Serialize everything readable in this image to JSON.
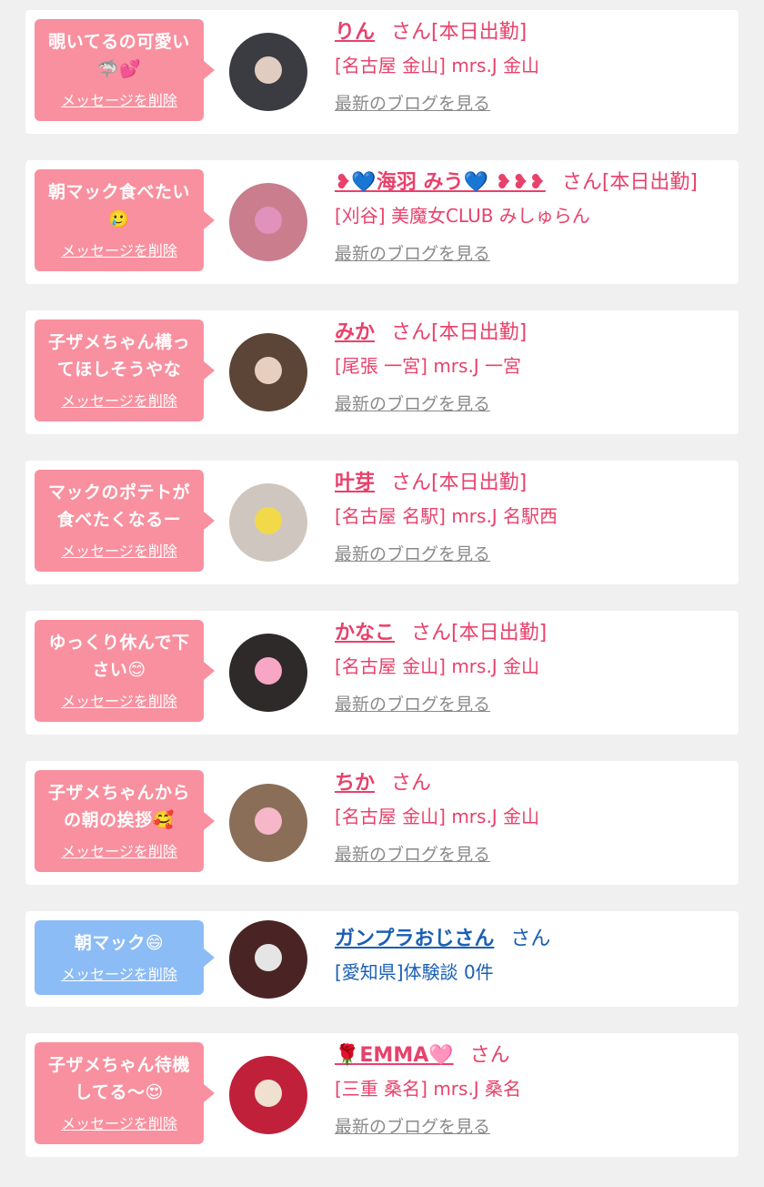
{
  "delete_label": "メッセージを削除",
  "blog_label": "最新のブログを見る",
  "san_label": "さん",
  "cards": [
    {
      "message": "覗いてるの可愛い🦈💕",
      "name": "りん",
      "status": "さん[本日出勤]",
      "shop": "[名古屋 金山] mrs.J 金山",
      "theme": "pink",
      "has_blog": true,
      "avatar_color": "#3b3b42"
    },
    {
      "message": "朝マック食べたい🥲",
      "name": "❥💙海羽 みう💙 ❥❥❥",
      "status": "さん[本日出勤]",
      "shop": "[刈谷] 美魔女CLUB みしゅらん",
      "theme": "pink",
      "has_blog": true,
      "avatar_color": "#c97d8d"
    },
    {
      "message": "子ザメちゃん構ってほしそうやな",
      "name": "みか",
      "status": "さん[本日出勤]",
      "shop": "[尾張 一宮] mrs.J 一宮",
      "theme": "pink",
      "has_blog": true,
      "avatar_color": "#5c4436"
    },
    {
      "message": "マックのポテトが食べたくなるー",
      "name": "叶芽",
      "status": "さん[本日出勤]",
      "shop": "[名古屋 名駅] mrs.J 名駅西",
      "theme": "pink",
      "has_blog": true,
      "avatar_color": "#cfc6bf"
    },
    {
      "message": "ゆっくり休んで下さい😊",
      "name": "かなこ",
      "status": "さん[本日出勤]",
      "shop": "[名古屋 金山] mrs.J 金山",
      "theme": "pink",
      "has_blog": true,
      "avatar_color": "#2e2a2a"
    },
    {
      "message": "子ザメちゃんからの朝の挨拶🥰",
      "name": "ちか",
      "status": "さん",
      "shop": "[名古屋 金山] mrs.J 金山",
      "theme": "pink",
      "has_blog": true,
      "avatar_color": "#8a6e58"
    },
    {
      "message": "朝マック😄",
      "name": "ガンプラおじさん",
      "status": "さん",
      "shop": "[愛知県]体験談 0件",
      "theme": "blue",
      "has_blog": false,
      "avatar_color": "#4a2424"
    },
    {
      "message": "子ザメちゃん待機してる〜😍",
      "name": "🌹EMMA🩷",
      "status": "さん",
      "shop": "[三重 桑名] mrs.J 桑名",
      "theme": "pink",
      "has_blog": true,
      "avatar_color": "#c0203a"
    }
  ]
}
